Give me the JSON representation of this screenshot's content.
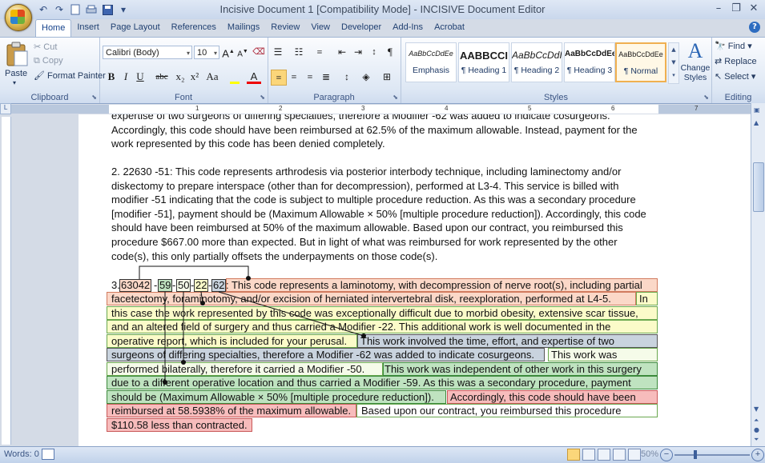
{
  "window": {
    "title": "Incisive Document 1 [Compatibility Mode] - INCISIVE Document Editor",
    "minimize": "–",
    "restore": "❐",
    "close": "✕"
  },
  "qat": {
    "undo": "↶",
    "redo": "↷"
  },
  "tabs": [
    "Home",
    "Insert",
    "Page Layout",
    "References",
    "Mailings",
    "Review",
    "View",
    "Developer",
    "Add-Ins",
    "Acrobat"
  ],
  "clipboard": {
    "paste": "Paste",
    "cut": "Cut",
    "copy": "Copy",
    "format_painter": "Format Painter",
    "label": "Clipboard"
  },
  "font": {
    "name": "Calibri (Body)",
    "size": "10",
    "label": "Font",
    "bold": "B",
    "italic": "I",
    "underline": "U",
    "strike": "abc",
    "sub": "x₂",
    "sup": "x²",
    "case": "Aa",
    "grow": "A",
    "shrink": "A"
  },
  "paragraph": {
    "label": "Paragraph"
  },
  "styles": {
    "label": "Styles",
    "tiles": [
      {
        "preview": "AaBbCcDdEe",
        "name": "Emphasis"
      },
      {
        "preview": "AABBCCI",
        "name": "¶ Heading 1"
      },
      {
        "preview": "AaBbCcDdI",
        "name": "¶ Heading 2"
      },
      {
        "preview": "AaBbCcDdEe",
        "name": "¶ Heading 3"
      },
      {
        "preview": "AaBbCcDdEe",
        "name": "¶ Normal"
      }
    ],
    "change_styles": "Change Styles"
  },
  "editing": {
    "label": "Editing",
    "find": "Find",
    "replace": "Replace",
    "select": "Select"
  },
  "ruler": {
    "numbers": [
      "1",
      "2",
      "3",
      "4",
      "5",
      "6",
      "7"
    ]
  },
  "doc": {
    "p0": "expertise of two surgeons of differing specialties, therefore a Modifier -62 was added to indicate cosurgeons. Accordingly, this code should have been reimbursed at 62.5% of the maximum allowable.  Instead, payment for the work represented by this code has been denied completely.",
    "p1": "2. 22630 -51: This code represents arthrodesis via posterior interbody technique, including laminectomy and/or diskectomy to prepare interspace (other than for decompression), performed at L3-4.  This service is billed with modifier -51 indicating that the code is subject to multiple procedure reduction.  As this was a secondary procedure [modifier -51], payment should be (Maximum Allowable × 50% [multiple procedure reduction]).  Accordingly, this code should have been reimbursed at 50% of the maximum allowable.  Based upon our contract, you reimbursed this procedure $667.00 more than expected.  But in light of what was reimbursed for work represented by the other code(s), this only partially offsets the underpayments on those code(s).",
    "p3": {
      "num": "3.",
      "code": "63042",
      "m59": "59",
      "m50": "50",
      "m22": "22",
      "m62": "62",
      "l1": ": This code represents a laminotomy, with decompression of nerve root(s), including partial",
      "l2a": "facetectomy, foraminotomy, and/or excision of herniated intervertebral disk, reexploration, performed at L4-5.",
      "l2b": "In",
      "l3": "this case the work represented by this code was exceptionally difficult due to morbid obesity, extensive scar tissue,",
      "l4": "and an altered field of surgery and thus carried a Modifier -22.  This additional work is well documented in the",
      "l5a": "operative report, which is included for your perusal.",
      "l5b": "This work involved the time, effort, and expertise of two",
      "l6a": "surgeons of differing specialties, therefore a Modifier -62 was added to indicate cosurgeons.",
      "l6b": "This work was",
      "l7a": "performed bilaterally, therefore it carried a Modifier -50.",
      "l7b": "This work was independent of other work in this surgery",
      "l8": "due to a different operative location and thus carried a Modifier -59.  As this was a secondary procedure, payment",
      "l9a": "should be (Maximum Allowable × 50% [multiple procedure reduction]).",
      "l9b": "Accordingly, this code should have been",
      "l10a": "reimbursed at 58.5938% of the maximum allowable.",
      "l10b": "Based upon our contract, you reimbursed this procedure",
      "l11": "$110.58 less than contracted."
    }
  },
  "status": {
    "words": "Words: 0",
    "zoom": "50%"
  }
}
